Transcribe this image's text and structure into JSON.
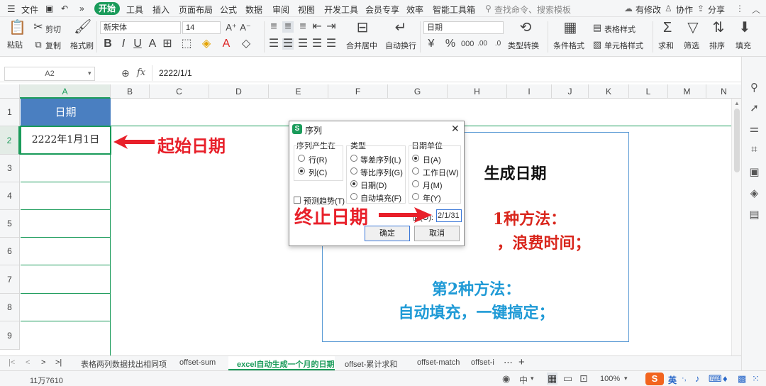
{
  "menubar": {
    "file": "文件",
    "tabs": [
      "开始",
      "工具",
      "插入",
      "页面布局",
      "公式",
      "数据",
      "审阅",
      "视图",
      "开发工具",
      "会员专享",
      "效率",
      "智能工具箱"
    ],
    "search_placeholder": "查找命令、搜索模板",
    "right": [
      "有修改",
      "协作",
      "分享"
    ]
  },
  "ribbon": {
    "paste": "粘贴",
    "cut": "剪切",
    "copy": "复制",
    "format_painter": "格式刷",
    "font_name": "新宋体",
    "font_size": "14",
    "merge_center": "合并居中",
    "wrap_text": "自动换行",
    "number_format": "日期",
    "type_convert": "类型转换",
    "cond_format": "条件格式",
    "table_style": "表格样式",
    "cell_style": "单元格样式",
    "sum": "求和",
    "filter": "筛选",
    "sort": "排序",
    "fill": "填充"
  },
  "formula_bar": {
    "name_box": "A2",
    "fx": "fx",
    "content": "2222/1/1"
  },
  "columns": [
    "A",
    "B",
    "C",
    "D",
    "E",
    "F",
    "G",
    "H",
    "I",
    "J",
    "K",
    "L",
    "M",
    "N"
  ],
  "rows": [
    "1",
    "2",
    "3",
    "4",
    "5",
    "6",
    "7",
    "8",
    "9"
  ],
  "cells": {
    "a1": "日期",
    "a2": "2222年1月1日"
  },
  "textbox": {
    "title_visible": "生成日期",
    "method1_visible": "1种方法：",
    "method1_desc_visible": "，浪费时间；",
    "method2": "第2种方法：",
    "method2_desc": "自动填充，一键搞定；"
  },
  "dialog": {
    "title": "序列",
    "group_series_in": "序列产生在",
    "row": "行(R)",
    "col": "列(C)",
    "group_type": "类型",
    "linear": "等差序列(L)",
    "growth": "等比序列(G)",
    "date": "日期(D)",
    "autofill": "自动填充(F)",
    "group_date_unit": "日期单位",
    "day": "日(A)",
    "weekday": "工作日(W)",
    "month": "月(M)",
    "year": "年(Y)",
    "trend": "预测趋势(T)",
    "stop_value_label": "值(O):",
    "stop_value": "2/1/31",
    "ok": "确定",
    "cancel": "取消"
  },
  "annotations": {
    "start_date": "起始日期",
    "end_date": "终止日期"
  },
  "sheets": [
    "表格两列数据找出相同项",
    "offset-sum",
    "excel自动生成一个月的日期",
    "offset-累计求和",
    "offset-match",
    "offset-i"
  ],
  "status": {
    "left": "11万7610",
    "zoom": "100%",
    "ime": "英"
  },
  "colors": {
    "accent": "#1a9b5a",
    "header_fill": "#4a7fc1",
    "annotation": "#e8202a",
    "method1": "#d9261c",
    "method2": "#1f9ad6"
  }
}
